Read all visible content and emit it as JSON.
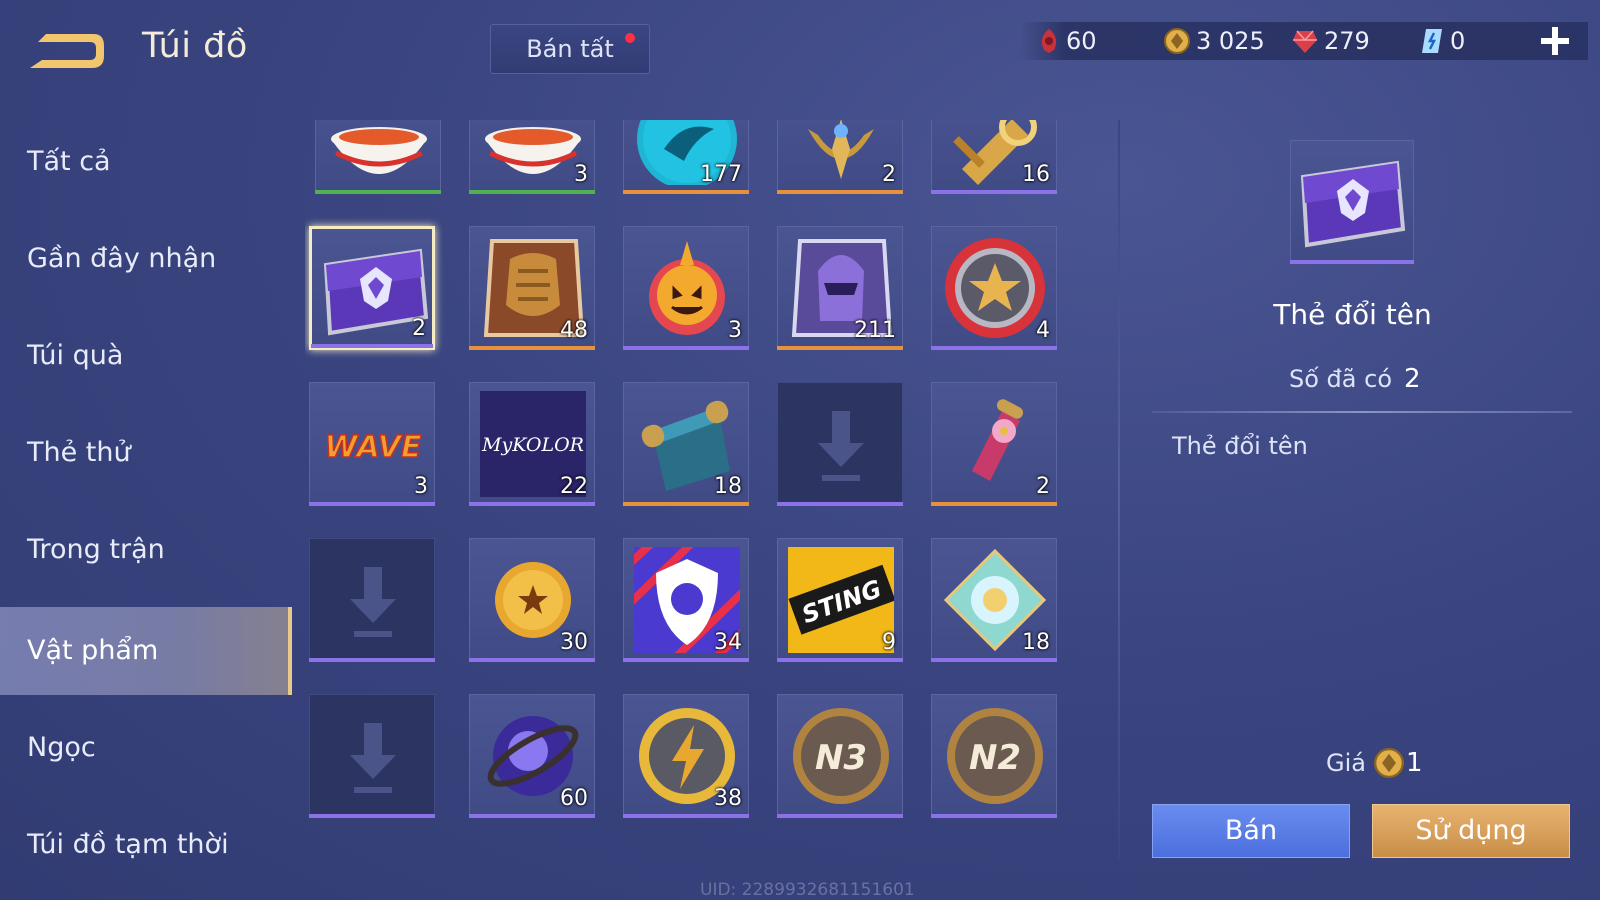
{
  "header": {
    "title": "Túi đồ",
    "sell_all": "Bán tất",
    "currencies": [
      {
        "icon": "red-voucher-icon",
        "value": "60"
      },
      {
        "icon": "gold-coin-icon",
        "value": "3 025"
      },
      {
        "icon": "ruby-gem-icon",
        "value": "279"
      },
      {
        "icon": "blue-crystal-icon",
        "value": "0"
      }
    ]
  },
  "sidebar": {
    "items": [
      {
        "label": "Tất cả",
        "active": false
      },
      {
        "label": "Gần đây nhận",
        "active": false
      },
      {
        "label": "Túi quà",
        "active": false
      },
      {
        "label": "Thẻ thử",
        "active": false
      },
      {
        "label": "Trong trận",
        "active": false
      },
      {
        "label": "Vật phẩm",
        "active": true
      },
      {
        "label": "Ngọc",
        "active": false
      },
      {
        "label": "Túi đồ tạm thời",
        "active": false
      }
    ]
  },
  "grid": {
    "rows": [
      [
        {
          "icon": "noodle-bowl-icon",
          "count": "",
          "rarity": "#4fb24f"
        },
        {
          "icon": "noodle-bowl-icon",
          "count": "3",
          "rarity": "#4fb24f"
        },
        {
          "icon": "blue-emblem-icon",
          "count": "177",
          "rarity": "#e8913c"
        },
        {
          "icon": "golden-crest-icon",
          "count": "2",
          "rarity": "#e8913c"
        },
        {
          "icon": "golden-cannon-icon",
          "count": "16",
          "rarity": "#8c72e8"
        }
      ],
      [
        {
          "icon": "rename-card-icon",
          "count": "2",
          "rarity": "#8c72e8",
          "selected": true
        },
        {
          "icon": "armor-box-icon",
          "count": "48",
          "rarity": "#e8913c"
        },
        {
          "icon": "pumpkin-icon",
          "count": "3",
          "rarity": "#8c72e8"
        },
        {
          "icon": "helmet-box-icon",
          "count": "211",
          "rarity": "#e8913c"
        },
        {
          "icon": "star-medal-icon",
          "count": "4",
          "rarity": "#8c72e8"
        }
      ],
      [
        {
          "icon": "wave-logo-icon",
          "count": "3",
          "rarity": "#8c72e8"
        },
        {
          "icon": "mykolor-logo-icon",
          "count": "22",
          "rarity": "#8c72e8"
        },
        {
          "icon": "scroll-icon",
          "count": "18",
          "rarity": "#e8913c"
        },
        {
          "icon": "download-placeholder-icon",
          "count": "",
          "rarity": "#8c72e8",
          "empty": true
        },
        {
          "icon": "blossom-scroll-icon",
          "count": "2",
          "rarity": "#e8913c"
        }
      ],
      [
        {
          "icon": "download-placeholder-icon",
          "count": "",
          "rarity": "#8c72e8",
          "empty": true
        },
        {
          "icon": "gold-star-coin-icon",
          "count": "30",
          "rarity": "#8c72e8"
        },
        {
          "icon": "lion-shield-icon",
          "count": "34",
          "rarity": "#8c72e8"
        },
        {
          "icon": "sting-logo-icon",
          "count": "9",
          "rarity": "#8c72e8"
        },
        {
          "icon": "crystal-diamond-icon",
          "count": "18",
          "rarity": "#8c72e8"
        }
      ],
      [
        {
          "icon": "download-placeholder-icon",
          "count": "",
          "rarity": "#8c72e8",
          "empty": true
        },
        {
          "icon": "orb-icon",
          "count": "60",
          "rarity": "#8c72e8"
        },
        {
          "icon": "lightning-coin-icon",
          "count": "38",
          "rarity": "#8c72e8"
        },
        {
          "icon": "n3-badge-icon",
          "count": "",
          "rarity": "#8c72e8"
        },
        {
          "icon": "n2-badge-icon",
          "count": "",
          "rarity": "#8c72e8"
        }
      ]
    ]
  },
  "detail": {
    "icon": "rename-card-icon",
    "name": "Thẻ đổi tên",
    "owned_label": "Số đã có",
    "owned_value": "2",
    "description": "Thẻ đổi tên",
    "price_label": "Giá",
    "price_value": "1",
    "sell_label": "Bán",
    "use_label": "Sử dụng"
  },
  "footer": {
    "uid": "UID: 2289932681151601"
  },
  "colors": {
    "accent_gold": "#e9c98a",
    "sell_blue": "#5b7de6",
    "use_orange": "#d9a05a",
    "rarity_purple": "#8c72e8",
    "rarity_orange": "#e8913c",
    "rarity_green": "#4fb24f"
  }
}
